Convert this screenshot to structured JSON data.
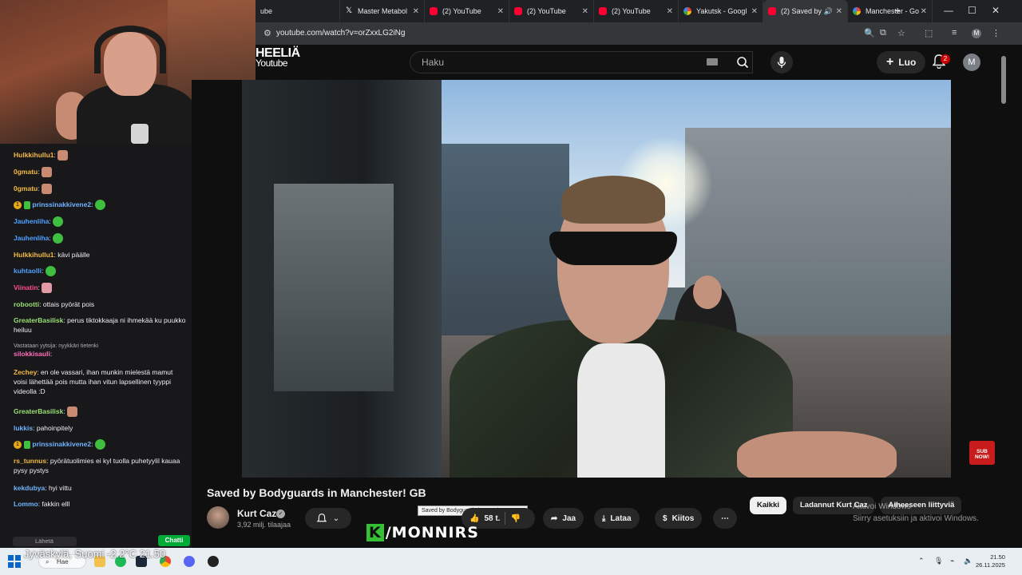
{
  "browser": {
    "tabs": [
      {
        "title": "ube",
        "icon": "youtube-icon"
      },
      {
        "title": "Master Metabol",
        "icon": "x-icon"
      },
      {
        "title": "(2) YouTube",
        "icon": "youtube-icon"
      },
      {
        "title": "(2) YouTube",
        "icon": "youtube-icon"
      },
      {
        "title": "(2) YouTube",
        "icon": "youtube-icon"
      },
      {
        "title": "Yakutsk - Googl",
        "icon": "google-icon"
      },
      {
        "title": "(2) Saved by",
        "icon": "youtube-icon"
      },
      {
        "title": "Manchester - Go",
        "icon": "google-icon"
      }
    ],
    "url": "youtube.com/watch?v=orZxxLG2iNg",
    "profile_initial": "M",
    "new_tab": "+"
  },
  "youtube": {
    "logo_line1": "HEELIÄ",
    "logo_line2": "Youtube",
    "search_placeholder": "Haku",
    "create_label": "Luo",
    "notifications_count": "2",
    "avatar_initial": "M",
    "video": {
      "title": "Saved by Bodyguards in Manchester! GB",
      "tooltip": "Saved by Bodyguards in Manchester! GB",
      "channel": "Kurt Caz",
      "subscribers": "3,92 milj. tilaajaa",
      "likes": "58 t.",
      "share_label": "Jaa",
      "download_label": "Lataa",
      "thanks_label": "Kiitos",
      "sub_now_badge": "SUB NOW!"
    },
    "chips": [
      "Kaikki",
      "Ladannut Kurt Caz",
      "Aiheeseen liittyviä"
    ],
    "chips_active_index": 0
  },
  "windows_activation": {
    "line1": "Aktivoi Windows",
    "line2": "Siirry asetuksiin ja aktivoi Windows."
  },
  "stream_overlay": {
    "brand": "/MONNIRS",
    "brand_letter": "K",
    "weather": "Jyväskylä, Suomi  -2.2°C  21.50"
  },
  "chat": {
    "messages": [
      {
        "user": "Hulkkihullu1",
        "color": "#f4b942",
        "text": "",
        "emote": "face"
      },
      {
        "user": "0gmatu",
        "color": "#f4b942",
        "text": "",
        "emote": "face"
      },
      {
        "user": "0gmatu",
        "color": "#f4b942",
        "text": "",
        "emote": "face"
      },
      {
        "user": "prinssinakkivene2",
        "color": "#6fb3ff",
        "text": "",
        "emote": "pepe",
        "badges": true
      },
      {
        "user": "Jauhenliha",
        "color": "#4ea1ff",
        "text": "",
        "emote": "pepe"
      },
      {
        "user": "Jauhenliha",
        "color": "#4ea1ff",
        "text": "",
        "emote": "pepe"
      },
      {
        "user": "Hulkkihullu1",
        "color": "#f4b942",
        "text": "kävi päälle"
      },
      {
        "user": "kuhtaolli",
        "color": "#4ea1ff",
        "text": "",
        "emote": "pepe"
      },
      {
        "user": "Viinatin",
        "color": "#ff4f8b",
        "text": "",
        "emote": "pink"
      },
      {
        "user": "robootti",
        "color": "#9adf74",
        "text": "ottais pyörät pois"
      },
      {
        "user": "GreaterBasilisk",
        "color": "#9adf74",
        "text": "perus tiktokkaaja ni ihmekää ku puukko heiluu"
      },
      {
        "user": "silokkisauli",
        "color": "#ff6dbd",
        "text": ""
      },
      {
        "user": "Zechey",
        "color": "#f4b942",
        "text": "en ole vassari, ihan munkin mielestä mamut voisi lähettää pois mutta ihan vitun lapsellinen tyyppi videolla :D"
      },
      {
        "user": "GreaterBasilisk",
        "color": "#9adf74",
        "text": "",
        "emote": "face"
      },
      {
        "user": "lukkis",
        "color": "#6fb3ff",
        "text": "pahoinpitely"
      },
      {
        "user": "prinssinakkivene2",
        "color": "#6fb3ff",
        "text": "",
        "emote": "pepe",
        "badges": true
      },
      {
        "user": "rs_tunnus",
        "color": "#f4b942",
        "text": "pyörätuolimies ei kyl tuolla puhetyylil kauaa pysy pystys"
      },
      {
        "user": "kekdubya",
        "color": "#6fb3ff",
        "text": "hyi vittu"
      },
      {
        "user": "Lommo",
        "color": "#6fb3ff",
        "text": "fakkin elll"
      }
    ],
    "reply_context": "Vastataan yytsija: nyykkäri tietenki",
    "input_placeholder": "Lähetä",
    "chat_button": "Chatti"
  },
  "taskbar": {
    "search_label": "Hae",
    "time": "21.50",
    "date": "26.11.2025"
  }
}
